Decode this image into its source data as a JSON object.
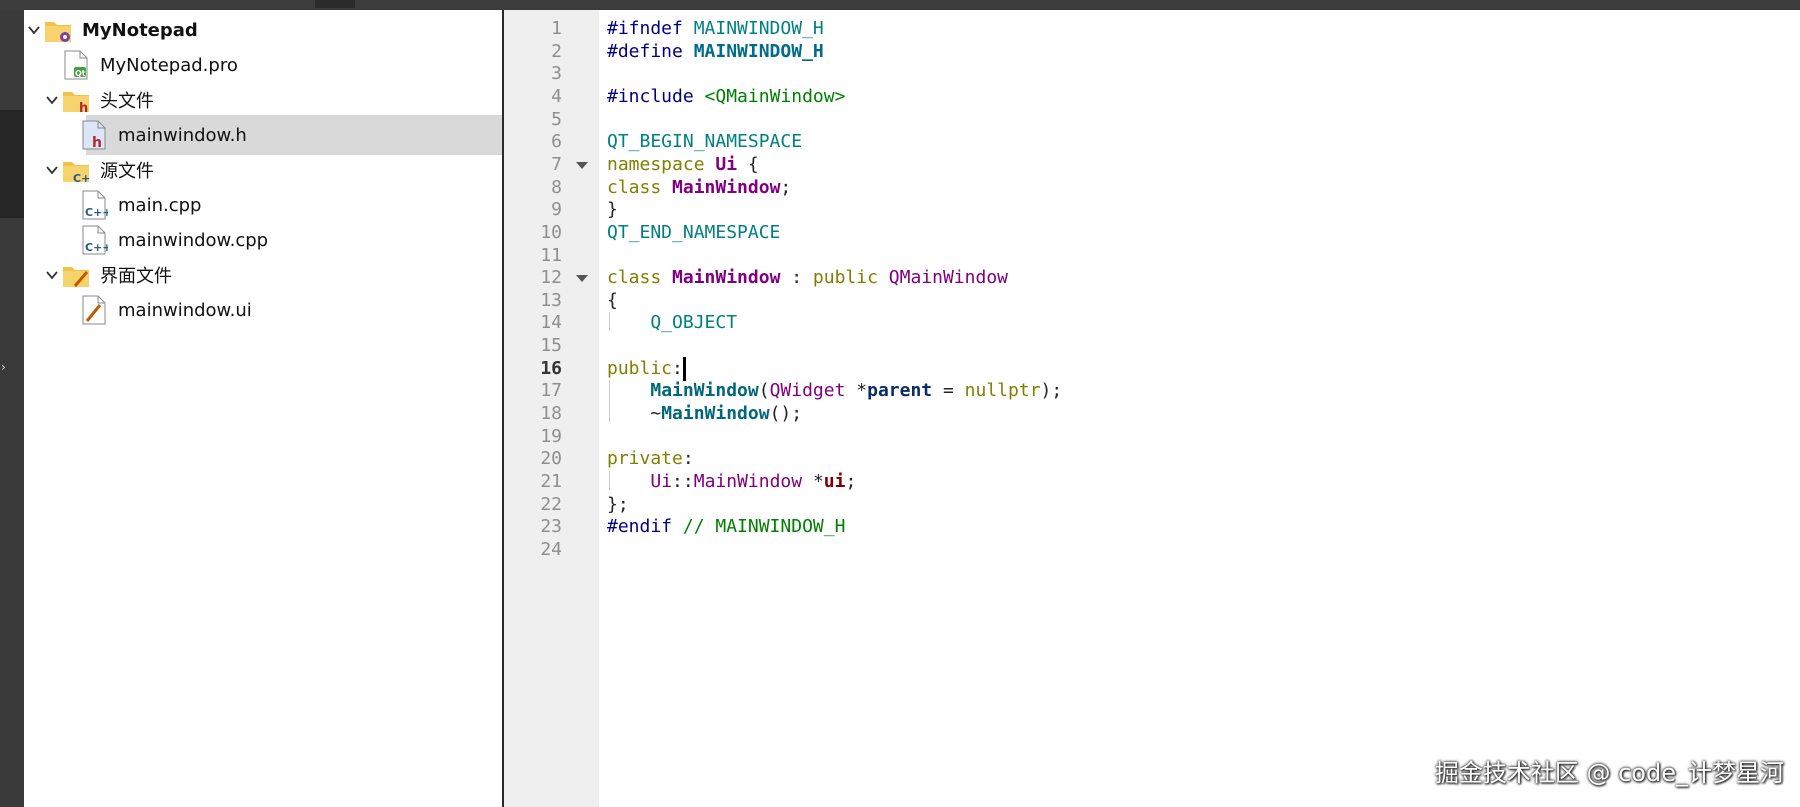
{
  "project_tree": {
    "root": {
      "label": "MyNotepad",
      "icon": "qt-project-folder-icon",
      "expanded": true
    },
    "items": [
      {
        "label": "MyNotepad.pro",
        "icon": "qt-pro-file-icon"
      },
      {
        "label": "头文件",
        "icon": "header-folder-icon",
        "expanded": true
      },
      {
        "label": "mainwindow.h",
        "icon": "header-file-icon",
        "selected": true
      },
      {
        "label": "源文件",
        "icon": "source-folder-icon",
        "expanded": true
      },
      {
        "label": "main.cpp",
        "icon": "cpp-file-icon"
      },
      {
        "label": "mainwindow.cpp",
        "icon": "cpp-file-icon"
      },
      {
        "label": "界面文件",
        "icon": "form-folder-icon",
        "expanded": true
      },
      {
        "label": "mainwindow.ui",
        "icon": "ui-file-icon"
      }
    ]
  },
  "editor": {
    "current_line": "16",
    "line_numbers": [
      "1",
      "2",
      "3",
      "4",
      "5",
      "6",
      "7",
      "8",
      "9",
      "10",
      "11",
      "12",
      "13",
      "14",
      "15",
      "16",
      "17",
      "18",
      "19",
      "20",
      "21",
      "22",
      "23",
      "24"
    ],
    "lines": [
      [
        {
          "t": "#ifndef ",
          "c": "pp"
        },
        {
          "t": "MAINWINDOW_H",
          "c": "mac"
        }
      ],
      [
        {
          "t": "#define ",
          "c": "pp"
        },
        {
          "t": "MAINWINDOW_H",
          "c": "bmac"
        }
      ],
      [],
      [
        {
          "t": "#include ",
          "c": "pp"
        },
        {
          "t": "<QMainWindow>",
          "c": "str"
        }
      ],
      [],
      [
        {
          "t": "QT_BEGIN_NAMESPACE",
          "c": "mac"
        }
      ],
      [
        {
          "t": "namespace ",
          "c": "kw"
        },
        {
          "t": "Ui",
          "c": "bcls"
        },
        {
          "t": " {",
          "c": "pl"
        }
      ],
      [
        {
          "t": "class ",
          "c": "kw"
        },
        {
          "t": "MainWindow",
          "c": "bcls"
        },
        {
          "t": ";",
          "c": "pl"
        }
      ],
      [
        {
          "t": "}",
          "c": "pl"
        }
      ],
      [
        {
          "t": "QT_END_NAMESPACE",
          "c": "mac"
        }
      ],
      [],
      [
        {
          "t": "class ",
          "c": "kw"
        },
        {
          "t": "MainWindow",
          "c": "bcls"
        },
        {
          "t": " : ",
          "c": "pl"
        },
        {
          "t": "public ",
          "c": "kw"
        },
        {
          "t": "QMainWindow",
          "c": "cls"
        }
      ],
      [
        {
          "t": "{",
          "c": "pl"
        }
      ],
      [
        {
          "t": "    Q_OBJECT",
          "c": "mac"
        }
      ],
      [],
      [
        {
          "t": "public",
          "c": "kw"
        },
        {
          "t": ":",
          "c": "pl"
        }
      ],
      [
        {
          "t": "    ",
          "c": "pl"
        },
        {
          "t": "MainWindow",
          "c": "fn"
        },
        {
          "t": "(",
          "c": "pl"
        },
        {
          "t": "QWidget ",
          "c": "cls"
        },
        {
          "t": "*",
          "c": "pl"
        },
        {
          "t": "parent",
          "c": "par"
        },
        {
          "t": " = ",
          "c": "pl"
        },
        {
          "t": "nullptr",
          "c": "kw"
        },
        {
          "t": ");",
          "c": "pl"
        }
      ],
      [
        {
          "t": "    ~",
          "c": "pl"
        },
        {
          "t": "MainWindow",
          "c": "fn"
        },
        {
          "t": "();",
          "c": "pl"
        }
      ],
      [],
      [
        {
          "t": "private",
          "c": "kw"
        },
        {
          "t": ":",
          "c": "pl"
        }
      ],
      [
        {
          "t": "    ",
          "c": "pl"
        },
        {
          "t": "Ui",
          "c": "ns"
        },
        {
          "t": "::",
          "c": "pl"
        },
        {
          "t": "MainWindow ",
          "c": "cls"
        },
        {
          "t": "*",
          "c": "pl"
        },
        {
          "t": "ui",
          "c": "mem"
        },
        {
          "t": ";",
          "c": "pl"
        }
      ],
      [
        {
          "t": "};",
          "c": "pl"
        }
      ],
      [
        {
          "t": "#endif ",
          "c": "pp"
        },
        {
          "t": "// MAINWINDOW_H",
          "c": "cmt"
        }
      ],
      []
    ],
    "fold_markers": [
      "7",
      "12"
    ]
  },
  "watermark": "掘金技术社区 @ code_计梦星河",
  "colors": {
    "selection_bg": "#d9d9d9",
    "gutter_bg": "#efefef",
    "sidebar_border": "#2a2a2a",
    "activity_bar": "#3a3a3a"
  }
}
